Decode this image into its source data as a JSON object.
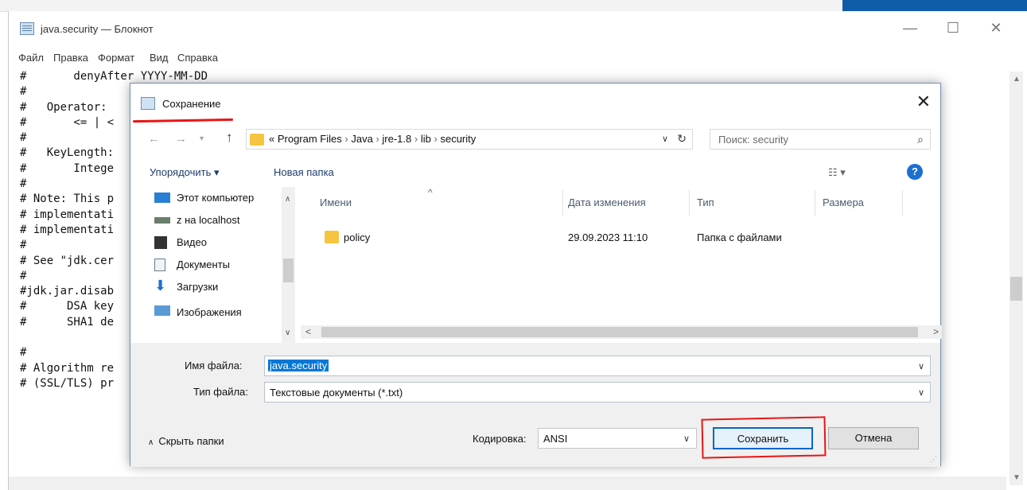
{
  "notepad": {
    "title": "java.security — Блокнот",
    "menu": [
      "Файл",
      "Правка",
      "Формат",
      "Вид",
      "Справка"
    ],
    "lines": [
      "#       denyAfter YYYY-MM-DD",
      "#",
      "#   Operator:",
      "#       <= | <",
      "#",
      "#   KeyLength:",
      "#       Intege",
      "#",
      "# Note: This p",
      "# implementati",
      "# implementati",
      "#",
      "# See \"jdk.cer",
      "#",
      "#jdk.jar.disab",
      "#      DSA key",
      "#      SHA1 de",
      "",
      "#",
      "# Algorithm re",
      "# (SSL/TLS) pr"
    ]
  },
  "dialog": {
    "title": "Сохранение",
    "address": {
      "path": [
        "« Program Files",
        "Java",
        "jre-1.8",
        "lib",
        "security"
      ],
      "separator": "›"
    },
    "search_placeholder": "Поиск: security",
    "toolbar": {
      "organize": "Упорядочить ▾",
      "new_folder": "Новая папка"
    },
    "nav_items": [
      {
        "icon": "computer-icon",
        "label": "Этот компьютер"
      },
      {
        "icon": "network-drive-icon",
        "label": "z на localhost"
      },
      {
        "icon": "video-icon",
        "label": "Видео"
      },
      {
        "icon": "documents-icon",
        "label": "Документы"
      },
      {
        "icon": "downloads-icon",
        "label": "Загрузки"
      },
      {
        "icon": "pictures-icon",
        "label": "Изображения"
      }
    ],
    "columns": [
      "Имени",
      "Дата изменения",
      "Тип",
      "Размера"
    ],
    "files": [
      {
        "name": "policy",
        "date": "29.09.2023 11:10",
        "type": "Папка с файлами",
        "size": ""
      }
    ],
    "filename_label": "Имя файла:",
    "filename_value": "java.security",
    "filetype_label": "Тип файла:",
    "filetype_value": "Текстовые документы (*.txt)",
    "hide_folders": "Скрыть папки",
    "encoding_label": "Кодировка:",
    "encoding_value": "ANSI",
    "save_label": "Сохранить",
    "cancel_label": "Отмена"
  },
  "colors": {
    "annotation_red": "#e81515",
    "accent_blue": "#0078d7",
    "folder_yellow": "#f5c542"
  }
}
